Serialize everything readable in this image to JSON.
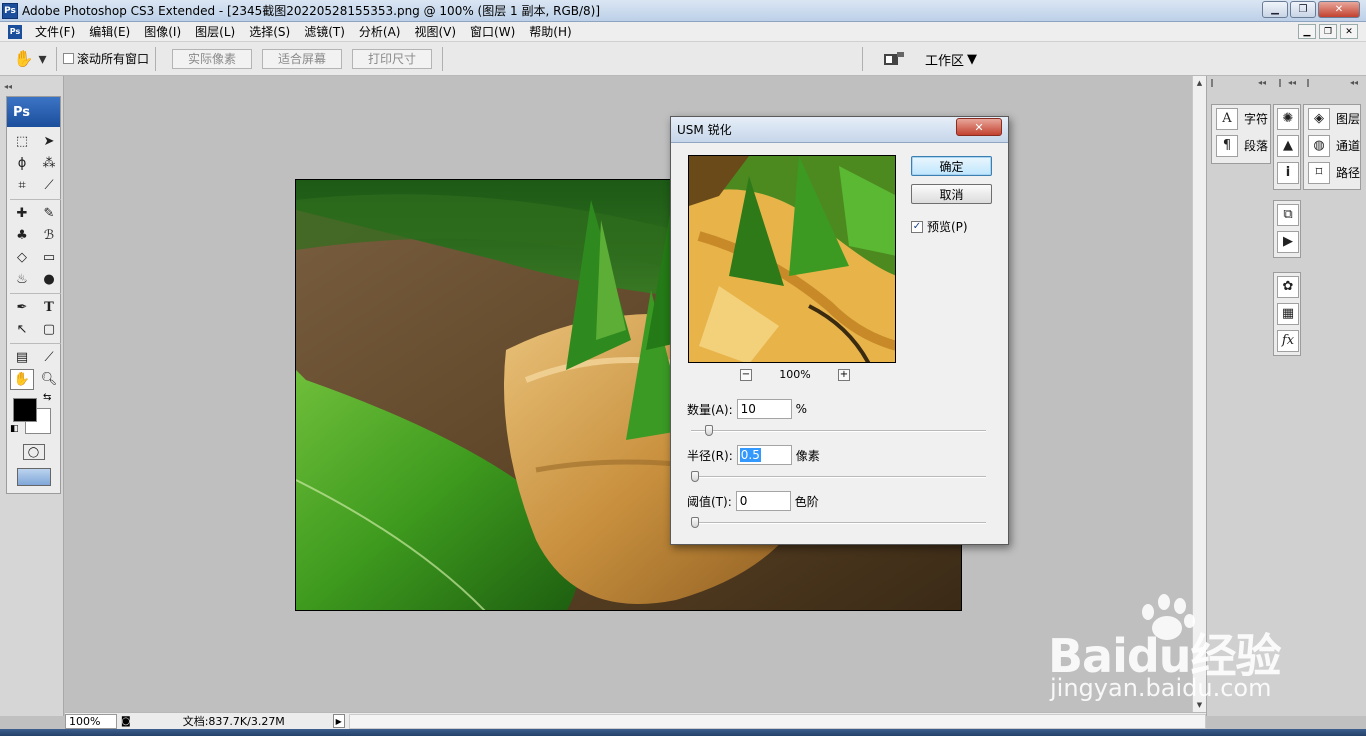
{
  "app": {
    "title": "Adobe Photoshop CS3 Extended - [2345截图20220528155353.png @ 100% (图层 1 副本, RGB/8)]",
    "logo": "Ps",
    "window_buttons": [
      "minimize-icon",
      "restore-icon",
      "close-icon"
    ]
  },
  "menu": {
    "items": [
      "文件(F)",
      "编辑(E)",
      "图像(I)",
      "图层(L)",
      "选择(S)",
      "滤镜(T)",
      "分析(A)",
      "视图(V)",
      "窗口(W)",
      "帮助(H)"
    ]
  },
  "options_bar": {
    "tool_icon": "hand-icon",
    "scroll_all_label": "滚动所有窗口",
    "scroll_all_checked": false,
    "buttons": [
      "实际像素",
      "适合屏幕",
      "打印尺寸"
    ],
    "workspace_label": "工作区",
    "bridge_icon": "bridge-icon"
  },
  "toolbox": {
    "logo": "Ps",
    "active_tool": "hand-tool",
    "foreground_color": "#000000",
    "background_color": "#ffffff"
  },
  "dialog": {
    "title": "USM 锐化",
    "close_label": "✕",
    "ok_label": "确定",
    "cancel_label": "取消",
    "preview_label": "预览(P)",
    "preview_checked": true,
    "zoom_label": "100%",
    "amount": {
      "label": "数量(A):",
      "value": "10",
      "unit": "%",
      "slider_fraction": 0.05
    },
    "radius": {
      "label": "半径(R):",
      "value": "0.5",
      "unit": "像素",
      "slider_fraction": 0.0
    },
    "threshold": {
      "label": "阈值(T):",
      "value": "0",
      "unit": "色阶",
      "slider_fraction": 0.0
    }
  },
  "panels": {
    "char_para": [
      {
        "icon": "character-icon",
        "label": "字符"
      },
      {
        "icon": "paragraph-icon",
        "label": "段落"
      }
    ],
    "layers_group": [
      {
        "icon": "layers-icon",
        "label": "图层"
      },
      {
        "icon": "channels-icon",
        "label": "通道"
      },
      {
        "icon": "paths-icon",
        "label": "路径"
      }
    ],
    "icon_column": [
      "navigator-icon",
      "histogram-icon",
      "info-icon",
      "history-icon",
      "actions-icon",
      "swatches-icon",
      "styles-icon",
      "fx-icon"
    ]
  },
  "status": {
    "zoom": "100%",
    "doc_info": "文档:837.7K/3.27M"
  },
  "watermark": {
    "logo_text": "Baidu经验",
    "url": "jingyan.baidu.com"
  }
}
